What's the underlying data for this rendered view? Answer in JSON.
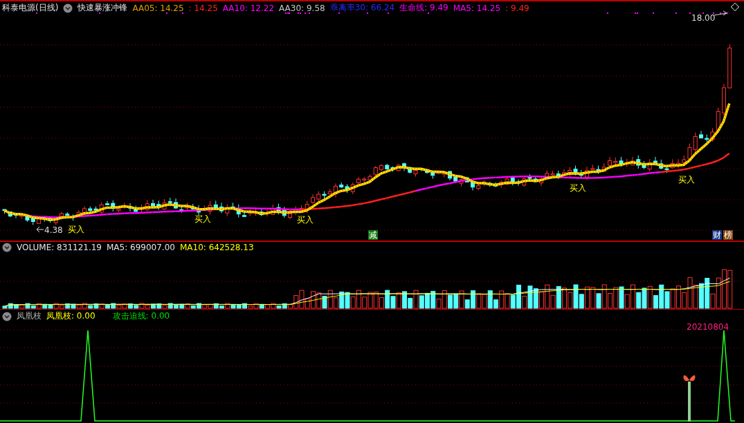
{
  "main_header": {
    "stock": "科泰电源(日线)",
    "indicator_name": "快速暴涨冲锋",
    "values": [
      {
        "text": "AA05: 14.25",
        "color": "#e0a000"
      },
      {
        "text": ": 14.25",
        "color": "#ff2020"
      },
      {
        "text": "AA10: 12.22",
        "color": "#ff00ff"
      },
      {
        "text": "AA30: 9.58",
        "color": "#c8c8c8"
      },
      {
        "text": "乖离率30: 66.24",
        "color": "#2a2aff"
      },
      {
        "text": "生命线: 9.49",
        "color": "#ff00ff"
      },
      {
        "text": "MA5: 14.25",
        "color": "#ff00ff"
      },
      {
        "text": ": 9.49",
        "color": "#ff2020"
      }
    ]
  },
  "main_chart": {
    "high_label": "18.00",
    "low_label": "4.38",
    "signals": [
      "买入",
      "买入",
      "买入",
      "买入",
      "买入"
    ],
    "badges": [
      {
        "text": "减",
        "color": "#167a16"
      },
      {
        "text": "财",
        "color": "#1a3a8a"
      },
      {
        "text": "榜",
        "color": "#8a4a10"
      }
    ]
  },
  "volume_panel": {
    "values": [
      {
        "text": "VOLUME: 831121.19",
        "color": "#e6e6e6"
      },
      {
        "text": "MA5: 699007.00",
        "color": "#e6e6e6"
      },
      {
        "text": "MA10: 642528.13",
        "color": "#ffff00"
      }
    ]
  },
  "indicator_panel": {
    "name": "凤凰枝",
    "values": [
      {
        "text": "凤凰枝: 0.00",
        "color": "#ffff00"
      },
      {
        "text": "攻击迫线: 0.00",
        "color": "#00e000"
      }
    ],
    "date_label": "20210804"
  }
}
